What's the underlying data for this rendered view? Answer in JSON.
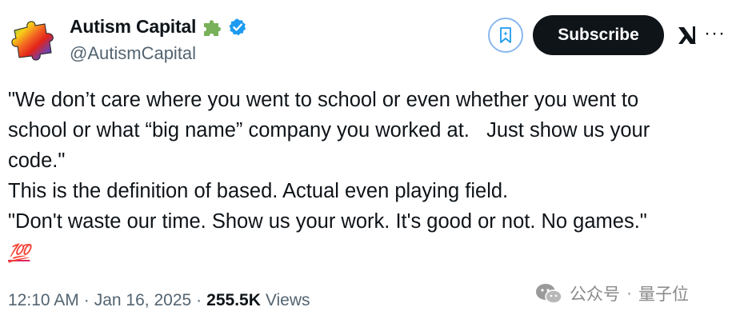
{
  "author": {
    "name": "Autism Capital",
    "handle": "@AutismCapital",
    "badge_icon": "puzzle-piece-icon",
    "verified_icon": "verified-badge-icon"
  },
  "header_actions": {
    "grok_icon": "bookmark-grok-icon",
    "subscribe_label": "Subscribe",
    "logo_icon": "xai-logo-icon",
    "more_label": "···"
  },
  "tweet": {
    "lines": [
      "\"We don’t care where you went to school or even whether you went to",
      "school or what “big name” company you worked at.   Just show us your",
      "code.\"",
      "This is the definition of based. Actual even playing field.",
      "\"Don't waste our time. Show us your work. It's good or not. No games.\""
    ],
    "emoji": "💯"
  },
  "meta": {
    "time": "12:10 AM",
    "sep1": "·",
    "date": "Jan 16, 2025",
    "sep2": "·",
    "views_count": "255.5K",
    "views_label": "Views"
  },
  "watermark": {
    "source": "公众号",
    "sep": "·",
    "name": "量子位"
  },
  "colors": {
    "subscribe_bg": "#0f1419",
    "verified_blue": "#1d9bf0",
    "puzzle_green": "#78b159",
    "muted_text": "#536471"
  }
}
